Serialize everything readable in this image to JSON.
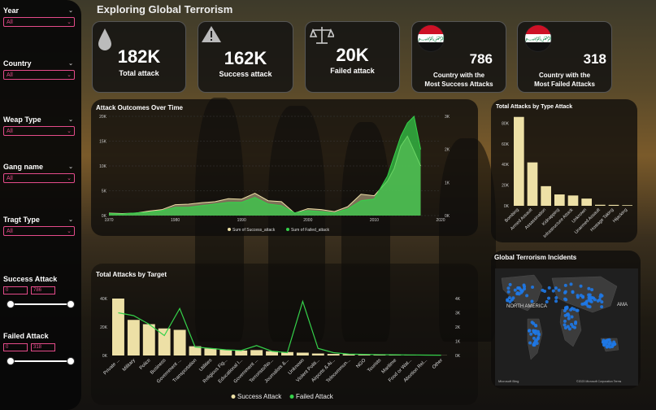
{
  "title": "Exploring Global Terrorism",
  "filters": {
    "year": {
      "label": "Year",
      "value": "All"
    },
    "country": {
      "label": "Country",
      "value": "All"
    },
    "weapon": {
      "label": "Weap Type",
      "value": "All"
    },
    "gang": {
      "label": "Gang name",
      "value": "All"
    },
    "target": {
      "label": "Tragt Type",
      "value": "All"
    },
    "success": {
      "label": "Success Attack",
      "min": "0",
      "max": "786"
    },
    "failed": {
      "label": "Failed Attack",
      "min": "0",
      "max": "318"
    }
  },
  "kpis": {
    "total": {
      "value": "182K",
      "label": "Total attack",
      "icon": "drop-icon"
    },
    "success": {
      "value": "162K",
      "label": "Success attack",
      "icon": "warning-icon"
    },
    "failed": {
      "value": "20K",
      "label": "Failed attack",
      "icon": "scales-icon"
    },
    "country_success": {
      "value": "786",
      "label1": "Country with the",
      "label2": "Most Success Attacks"
    },
    "country_failed": {
      "value": "318",
      "label1": "Country with the",
      "label2": "Most Failed Attacks"
    }
  },
  "colors": {
    "success": "#ede0a6",
    "failed": "#35d14a",
    "accent": "#e44b8a",
    "dot": "#1e78e6"
  },
  "chart_data": [
    {
      "type": "area",
      "title": "Attack Outcomes Over Time",
      "x": [
        1970,
        1972,
        1974,
        1976,
        1978,
        1980,
        1982,
        1984,
        1986,
        1988,
        1990,
        1992,
        1994,
        1996,
        1998,
        2000,
        2002,
        2004,
        2006,
        2008,
        2010,
        2012,
        2013,
        2014,
        2015,
        2016,
        2017
      ],
      "series": [
        {
          "name": "Sum of Success_attack",
          "axis": "left",
          "values": [
            500,
            400,
            500,
            900,
            1200,
            2200,
            2300,
            2600,
            2800,
            3400,
            3300,
            4500,
            3000,
            2800,
            500,
            1400,
            1200,
            800,
            1800,
            4300,
            4000,
            7000,
            9500,
            14000,
            16000,
            13000,
            10000
          ]
        },
        {
          "name": "Sum of Failed_attack",
          "axis": "right",
          "values": [
            60,
            50,
            80,
            100,
            150,
            250,
            250,
            300,
            350,
            400,
            400,
            550,
            350,
            300,
            80,
            150,
            120,
            80,
            200,
            450,
            500,
            1200,
            1800,
            2400,
            2800,
            3000,
            2000
          ]
        }
      ],
      "ylim_left": [
        0,
        20000
      ],
      "yticks_left": [
        "0K",
        "5K",
        "10K",
        "15K",
        "20K"
      ],
      "ylim_right": [
        0,
        3000
      ],
      "yticks_right": [
        "0K",
        "1K",
        "2K",
        "3K"
      ],
      "xticks": [
        "1970",
        "1980",
        "1990",
        "2000",
        "2010",
        "2020"
      ],
      "legend": [
        "Sum of Success_attack",
        "Sum of Failed_attack"
      ]
    },
    {
      "type": "bar",
      "title": "Total Attacks by Type Attack",
      "categories": [
        "Bombing",
        "Armed Assault",
        "Assassination",
        "Kidnapping",
        "Infrastructure Attack",
        "Unknown",
        "Unarmed Assault",
        "Hostage Taking",
        "Hijacking"
      ],
      "values": [
        86000,
        42000,
        19000,
        11000,
        10000,
        7000,
        1000,
        900,
        600
      ],
      "ylim": [
        0,
        85000
      ],
      "yticks": [
        "0K",
        "20K",
        "40K",
        "60K",
        "80K"
      ]
    },
    {
      "type": "bar",
      "title": "Total Attacks by Target",
      "categories": [
        "Private ...",
        "Military",
        "Police",
        "Business",
        "Government ...",
        "Transportation",
        "Utilities",
        "Religious Fig...",
        "Educational I...",
        "Government ...",
        "Terrorists/No...",
        "Journalists &...",
        "Unknown",
        "Violent Politi...",
        "Airports & Ai...",
        "Telecommun...",
        "NGO",
        "Tourists",
        "Maritime",
        "Food or Wat...",
        "Abortion Rel...",
        "Other"
      ],
      "series": [
        {
          "name": "Success Attack",
          "axis": "left",
          "values": [
            40000,
            25000,
            22000,
            19000,
            18000,
            6500,
            5000,
            4000,
            3500,
            3800,
            3000,
            2400,
            2000,
            1400,
            1100,
            900,
            500,
            350,
            300,
            200,
            150,
            100
          ]
        },
        {
          "name": "Failed Attack",
          "axis": "right",
          "values": [
            3000,
            2800,
            2200,
            1400,
            3300,
            600,
            500,
            400,
            350,
            700,
            300,
            200,
            3800,
            500,
            200,
            100,
            80,
            60,
            50,
            40,
            30,
            20
          ]
        }
      ],
      "ylim_left": [
        0,
        40000
      ],
      "yticks_left": [
        "0K",
        "20K",
        "40K"
      ],
      "ylim_right": [
        0,
        4000
      ],
      "yticks_right": [
        "0K",
        "1K",
        "2K",
        "3K",
        "4K"
      ],
      "legend": [
        "Success Attack",
        "Failed Attack"
      ]
    }
  ],
  "map": {
    "title": "Global Terrorism Incidents",
    "labels": [
      "NORTH AMERICA",
      "AMA"
    ],
    "attribution": "©2023 Microsoft Corporation Terms",
    "brand": "Microsoft Bing"
  }
}
